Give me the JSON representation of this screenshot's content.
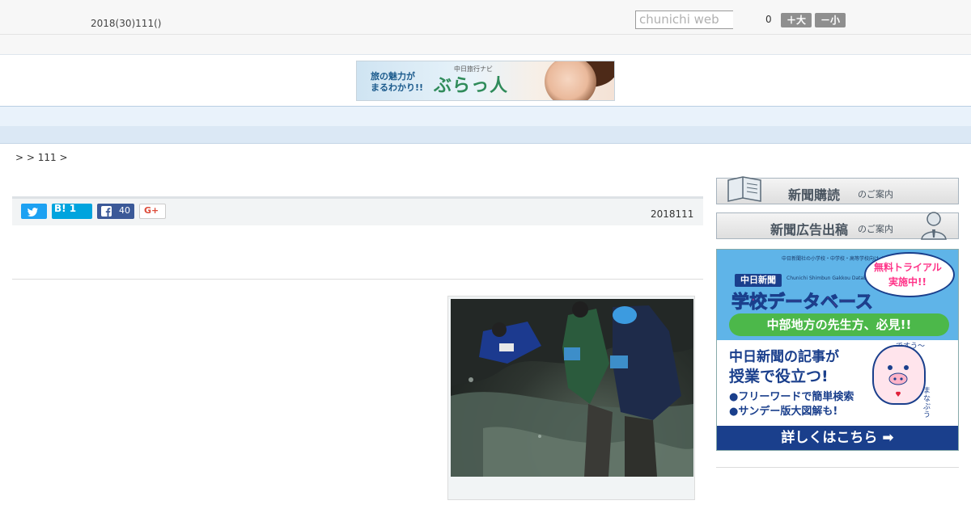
{
  "header": {
    "date_line": "2018(30)111()",
    "search_placeholder": "chunichi web",
    "font_size_counter": "0",
    "font_bigger_label": "＋大",
    "font_smaller_label": "－小"
  },
  "banner": {
    "tagline_line1": "旅の魅力が",
    "tagline_line2": "まるわかり!!",
    "brand_small": "中日旅行ナビ",
    "brand_logo": "ぶらっ人"
  },
  "nav": {
    "items": [
      "",
      "",
      "",
      "",
      "",
      "",
      "",
      "",
      ""
    ]
  },
  "breadcrumb": ">  > 111 >",
  "share": {
    "twitter_icon": "twitter-bird-icon",
    "hatena_label": "B! 1",
    "facebook_count": "40",
    "gplus_label": "G+"
  },
  "article": {
    "date": "2018111"
  },
  "sidebar": {
    "subscribe_main": "新聞購読",
    "subscribe_sub": "のご案内",
    "advertise_main": "新聞広告出稿",
    "advertise_sub": "のご案内",
    "school_ad": {
      "top_line": "中日新聞社の小学校・中学校・高等学校向けインターネットサービス",
      "title1": "中日新聞",
      "title2": "学校データベース",
      "en_sub": "Chunichi Shimbun Gakkou Database",
      "bubble_line1": "無料トライアル",
      "bubble_line2": "実施中!!",
      "green_banner": "中部地方の先生方、必見!!",
      "line1": "中日新聞の記事が",
      "line2": "授業で役立つ!",
      "bullet1": "●フリーワードで簡単検索",
      "bullet2": "●サンデー版大図解も!",
      "pig_say": "ですう〜",
      "pig_name": "まなぶう",
      "cta": "詳しくはこちら ➡"
    }
  },
  "colors": {
    "twitter": "#1da1f2",
    "hatena": "#00a4de",
    "facebook": "#3b5998",
    "nav_bg": "#e9f2fb",
    "ad_navy": "#1a3f8c",
    "ad_pink": "#ff2f8f",
    "ad_green": "#4cb84a"
  }
}
